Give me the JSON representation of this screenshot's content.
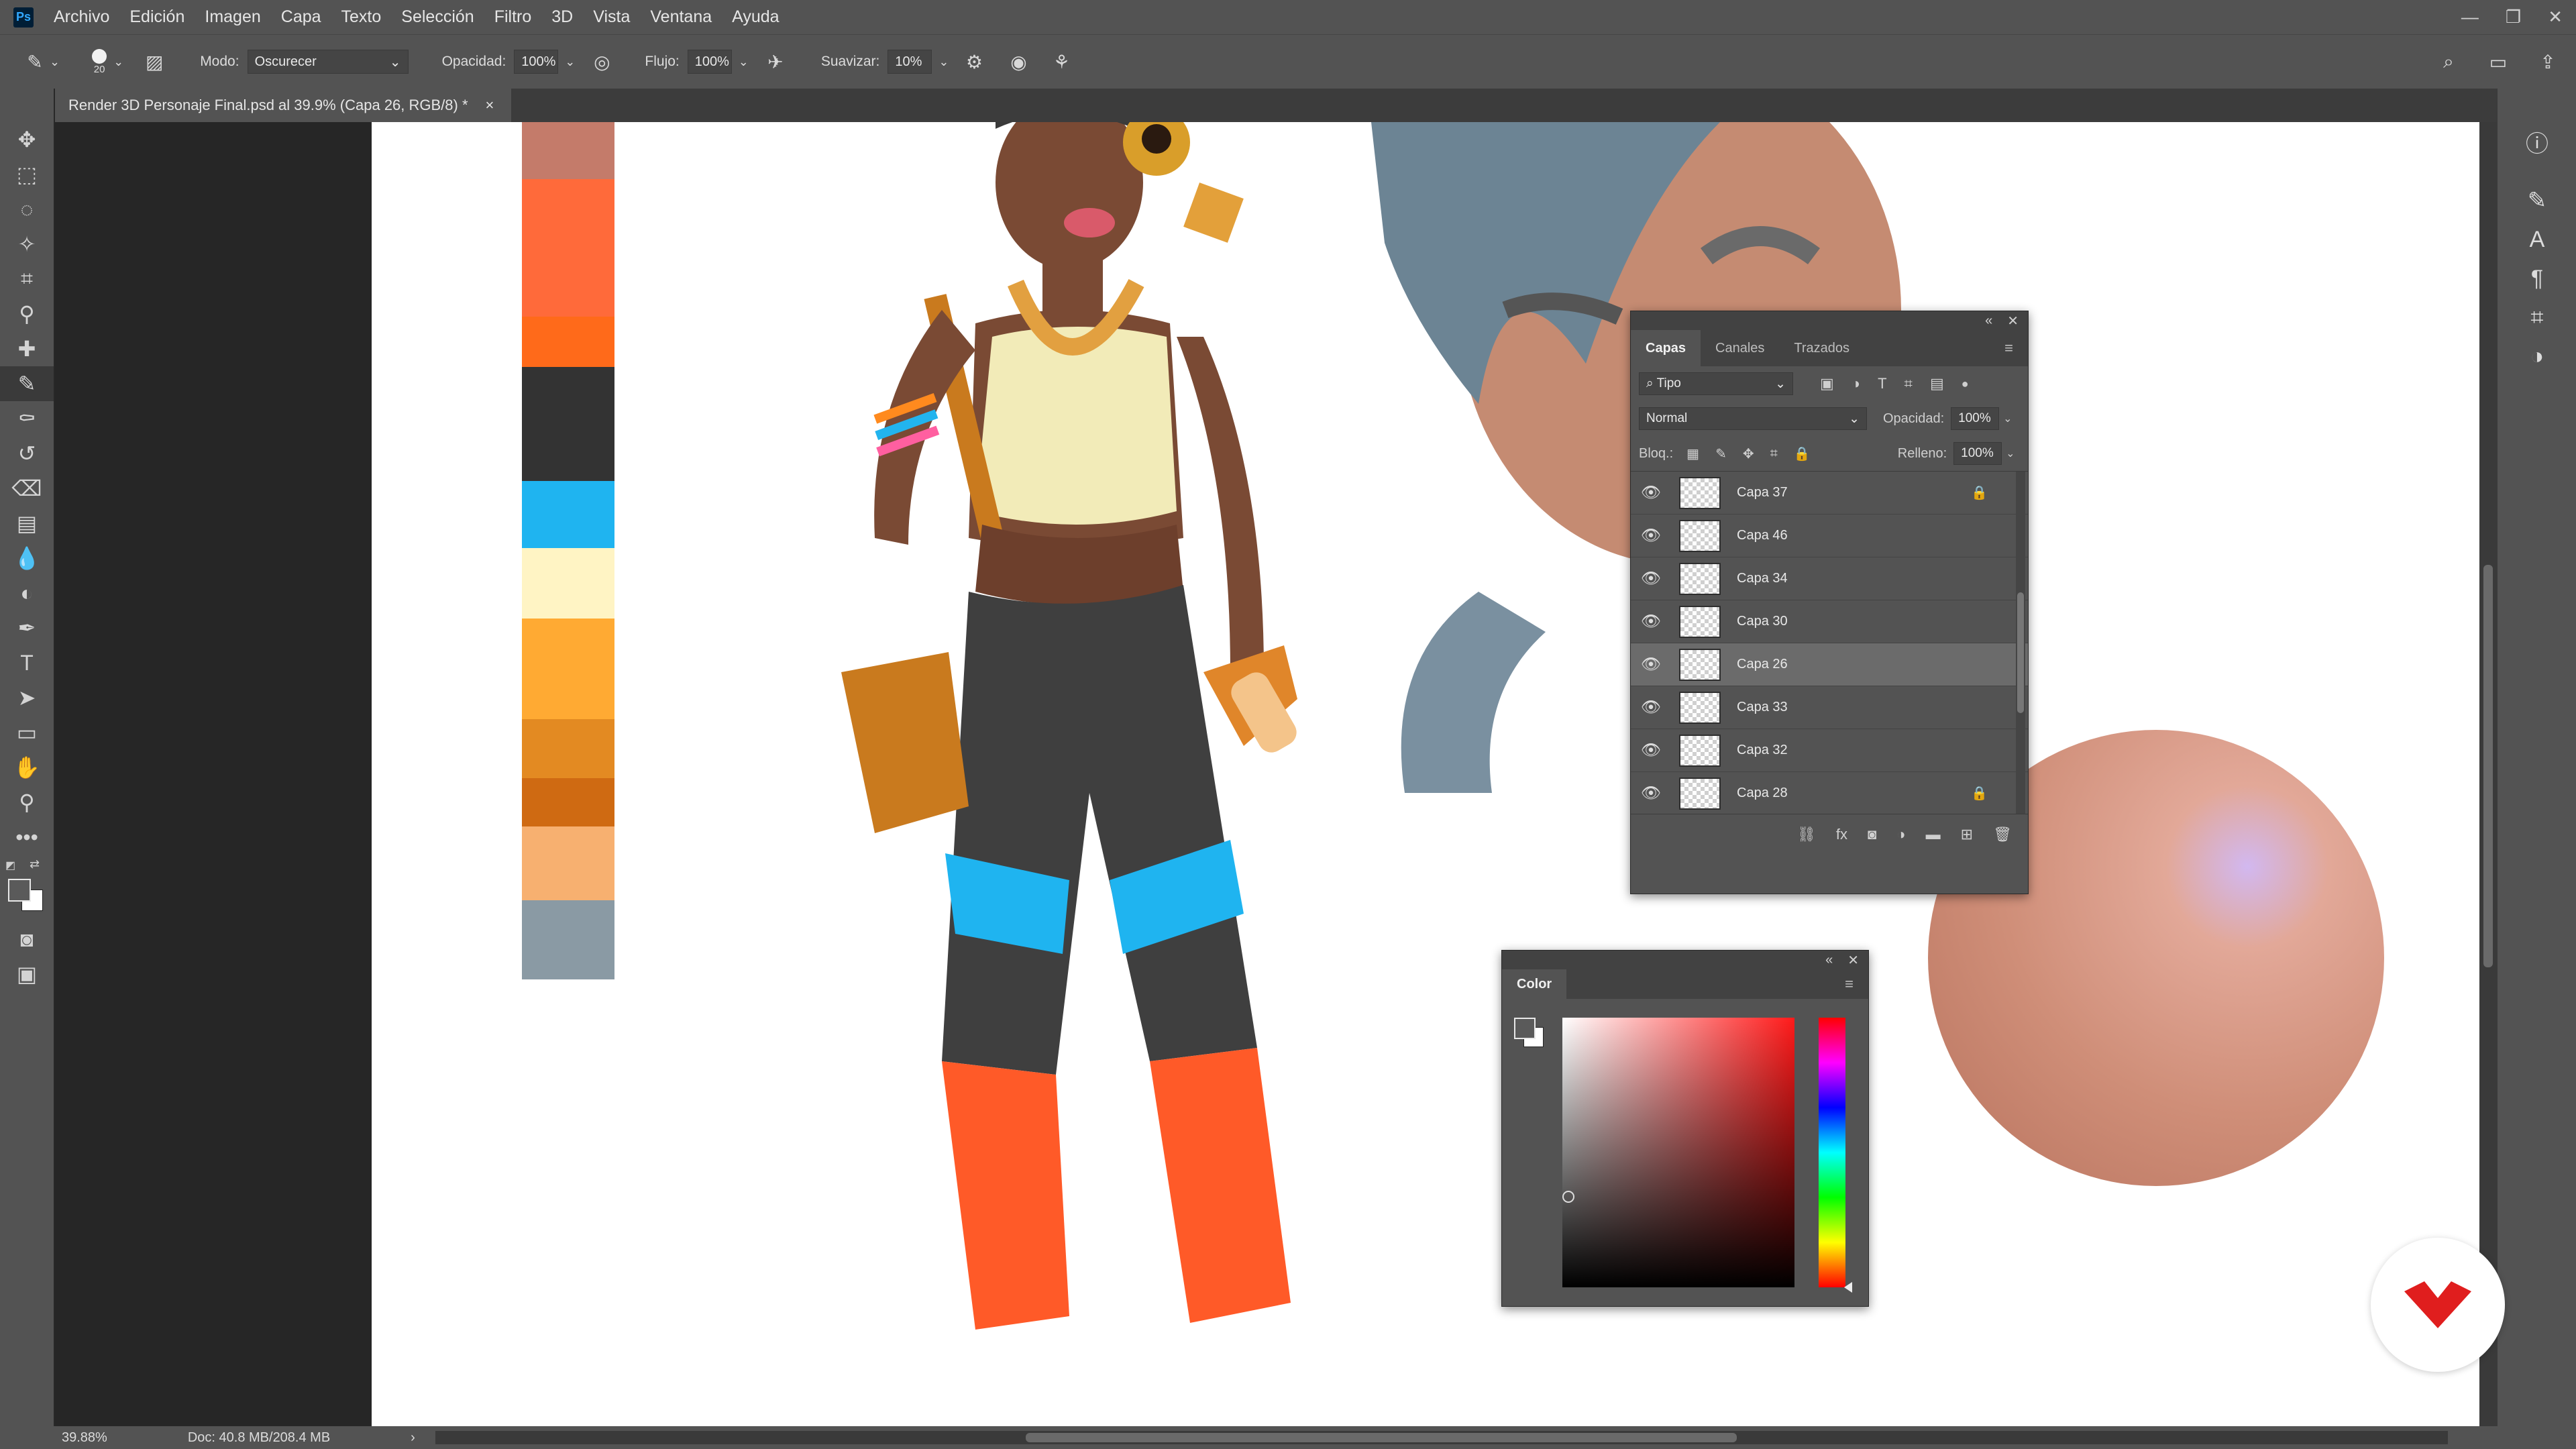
{
  "menubar": {
    "logo": "Ps",
    "items": [
      "Archivo",
      "Edición",
      "Imagen",
      "Capa",
      "Texto",
      "Selección",
      "Filtro",
      "3D",
      "Vista",
      "Ventana",
      "Ayuda"
    ]
  },
  "options": {
    "brush_size": "20",
    "mode_label": "Modo:",
    "mode_value": "Oscurecer",
    "opacity_label": "Opacidad:",
    "opacity_value": "100%",
    "flow_label": "Flujo:",
    "flow_value": "100%",
    "smooth_label": "Suavizar:",
    "smooth_value": "10%"
  },
  "document": {
    "tab_title": "Render 3D Personaje Final.psd al 39.9% (Capa 26, RGB/8) *",
    "close": "×"
  },
  "layers_panel": {
    "tabs": [
      "Capas",
      "Canales",
      "Trazados"
    ],
    "filter_label": "Tipo",
    "blend_mode": "Normal",
    "opacity_label": "Opacidad:",
    "opacity_value": "100%",
    "lock_label": "Bloq.:",
    "fill_label": "Relleno:",
    "fill_value": "100%",
    "layers": [
      {
        "name": "Capa 37",
        "locked": true
      },
      {
        "name": "Capa 46",
        "locked": false
      },
      {
        "name": "Capa 34",
        "locked": false
      },
      {
        "name": "Capa 30",
        "locked": false
      },
      {
        "name": "Capa 26",
        "locked": false,
        "selected": true
      },
      {
        "name": "Capa 33",
        "locked": false
      },
      {
        "name": "Capa 32",
        "locked": false
      },
      {
        "name": "Capa 28",
        "locked": true
      }
    ]
  },
  "color_panel": {
    "title": "Color",
    "hue_color": "#ff1a1a"
  },
  "statusbar": {
    "zoom": "39.88%",
    "doc_info": "Doc: 40.8 MB/208.4 MB"
  },
  "palette_colors": [
    "#c47b6a",
    "#ff6a3a",
    "#ff6a1a",
    "#333333",
    "#1fb4f0",
    "#fff4c4",
    "#ffaa33",
    "#e38a22",
    "#cf6a12",
    "#f7b070",
    "#8a9aa4"
  ]
}
